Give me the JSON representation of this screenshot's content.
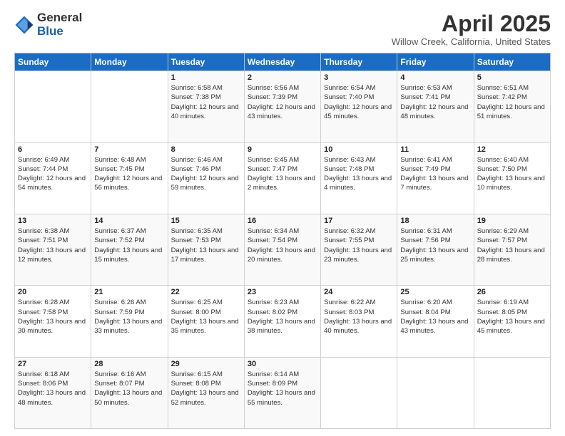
{
  "logo": {
    "general": "General",
    "blue": "Blue"
  },
  "title": "April 2025",
  "location": "Willow Creek, California, United States",
  "days_of_week": [
    "Sunday",
    "Monday",
    "Tuesday",
    "Wednesday",
    "Thursday",
    "Friday",
    "Saturday"
  ],
  "weeks": [
    [
      {
        "day": "",
        "info": ""
      },
      {
        "day": "",
        "info": ""
      },
      {
        "day": "1",
        "info": "Sunrise: 6:58 AM\nSunset: 7:38 PM\nDaylight: 12 hours and 40 minutes."
      },
      {
        "day": "2",
        "info": "Sunrise: 6:56 AM\nSunset: 7:39 PM\nDaylight: 12 hours and 43 minutes."
      },
      {
        "day": "3",
        "info": "Sunrise: 6:54 AM\nSunset: 7:40 PM\nDaylight: 12 hours and 45 minutes."
      },
      {
        "day": "4",
        "info": "Sunrise: 6:53 AM\nSunset: 7:41 PM\nDaylight: 12 hours and 48 minutes."
      },
      {
        "day": "5",
        "info": "Sunrise: 6:51 AM\nSunset: 7:42 PM\nDaylight: 12 hours and 51 minutes."
      }
    ],
    [
      {
        "day": "6",
        "info": "Sunrise: 6:49 AM\nSunset: 7:44 PM\nDaylight: 12 hours and 54 minutes."
      },
      {
        "day": "7",
        "info": "Sunrise: 6:48 AM\nSunset: 7:45 PM\nDaylight: 12 hours and 56 minutes."
      },
      {
        "day": "8",
        "info": "Sunrise: 6:46 AM\nSunset: 7:46 PM\nDaylight: 12 hours and 59 minutes."
      },
      {
        "day": "9",
        "info": "Sunrise: 6:45 AM\nSunset: 7:47 PM\nDaylight: 13 hours and 2 minutes."
      },
      {
        "day": "10",
        "info": "Sunrise: 6:43 AM\nSunset: 7:48 PM\nDaylight: 13 hours and 4 minutes."
      },
      {
        "day": "11",
        "info": "Sunrise: 6:41 AM\nSunset: 7:49 PM\nDaylight: 13 hours and 7 minutes."
      },
      {
        "day": "12",
        "info": "Sunrise: 6:40 AM\nSunset: 7:50 PM\nDaylight: 13 hours and 10 minutes."
      }
    ],
    [
      {
        "day": "13",
        "info": "Sunrise: 6:38 AM\nSunset: 7:51 PM\nDaylight: 13 hours and 12 minutes."
      },
      {
        "day": "14",
        "info": "Sunrise: 6:37 AM\nSunset: 7:52 PM\nDaylight: 13 hours and 15 minutes."
      },
      {
        "day": "15",
        "info": "Sunrise: 6:35 AM\nSunset: 7:53 PM\nDaylight: 13 hours and 17 minutes."
      },
      {
        "day": "16",
        "info": "Sunrise: 6:34 AM\nSunset: 7:54 PM\nDaylight: 13 hours and 20 minutes."
      },
      {
        "day": "17",
        "info": "Sunrise: 6:32 AM\nSunset: 7:55 PM\nDaylight: 13 hours and 23 minutes."
      },
      {
        "day": "18",
        "info": "Sunrise: 6:31 AM\nSunset: 7:56 PM\nDaylight: 13 hours and 25 minutes."
      },
      {
        "day": "19",
        "info": "Sunrise: 6:29 AM\nSunset: 7:57 PM\nDaylight: 13 hours and 28 minutes."
      }
    ],
    [
      {
        "day": "20",
        "info": "Sunrise: 6:28 AM\nSunset: 7:58 PM\nDaylight: 13 hours and 30 minutes."
      },
      {
        "day": "21",
        "info": "Sunrise: 6:26 AM\nSunset: 7:59 PM\nDaylight: 13 hours and 33 minutes."
      },
      {
        "day": "22",
        "info": "Sunrise: 6:25 AM\nSunset: 8:00 PM\nDaylight: 13 hours and 35 minutes."
      },
      {
        "day": "23",
        "info": "Sunrise: 6:23 AM\nSunset: 8:02 PM\nDaylight: 13 hours and 38 minutes."
      },
      {
        "day": "24",
        "info": "Sunrise: 6:22 AM\nSunset: 8:03 PM\nDaylight: 13 hours and 40 minutes."
      },
      {
        "day": "25",
        "info": "Sunrise: 6:20 AM\nSunset: 8:04 PM\nDaylight: 13 hours and 43 minutes."
      },
      {
        "day": "26",
        "info": "Sunrise: 6:19 AM\nSunset: 8:05 PM\nDaylight: 13 hours and 45 minutes."
      }
    ],
    [
      {
        "day": "27",
        "info": "Sunrise: 6:18 AM\nSunset: 8:06 PM\nDaylight: 13 hours and 48 minutes."
      },
      {
        "day": "28",
        "info": "Sunrise: 6:16 AM\nSunset: 8:07 PM\nDaylight: 13 hours and 50 minutes."
      },
      {
        "day": "29",
        "info": "Sunrise: 6:15 AM\nSunset: 8:08 PM\nDaylight: 13 hours and 52 minutes."
      },
      {
        "day": "30",
        "info": "Sunrise: 6:14 AM\nSunset: 8:09 PM\nDaylight: 13 hours and 55 minutes."
      },
      {
        "day": "",
        "info": ""
      },
      {
        "day": "",
        "info": ""
      },
      {
        "day": "",
        "info": ""
      }
    ]
  ]
}
